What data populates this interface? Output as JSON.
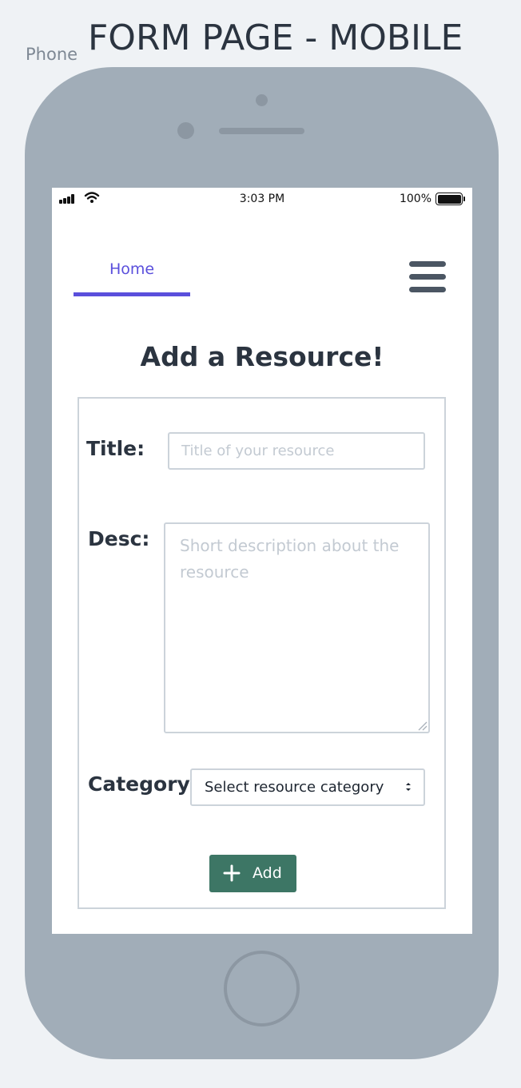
{
  "header": {
    "label": "Phone",
    "title": "FORM PAGE - MOBILE"
  },
  "statusbar": {
    "time": "3:03 PM",
    "battery": "100%",
    "icons": [
      "signal-icon",
      "wifi-icon",
      "battery-icon"
    ]
  },
  "nav": {
    "home_label": "Home",
    "accent_color": "#5a4fdc",
    "menu_icon": "hamburger-menu-icon"
  },
  "form": {
    "heading": "Add a Resource!",
    "title_label": "Title:",
    "title_value": "",
    "title_placeholder": "Title of your resource",
    "desc_label": "Desc:",
    "desc_value": "",
    "desc_placeholder": "Short description about the resource",
    "category_label": "Category:",
    "category_selected": "Select resource category",
    "add_label": "Add",
    "add_icon": "plus-icon",
    "add_button_color": "#3d7665"
  }
}
